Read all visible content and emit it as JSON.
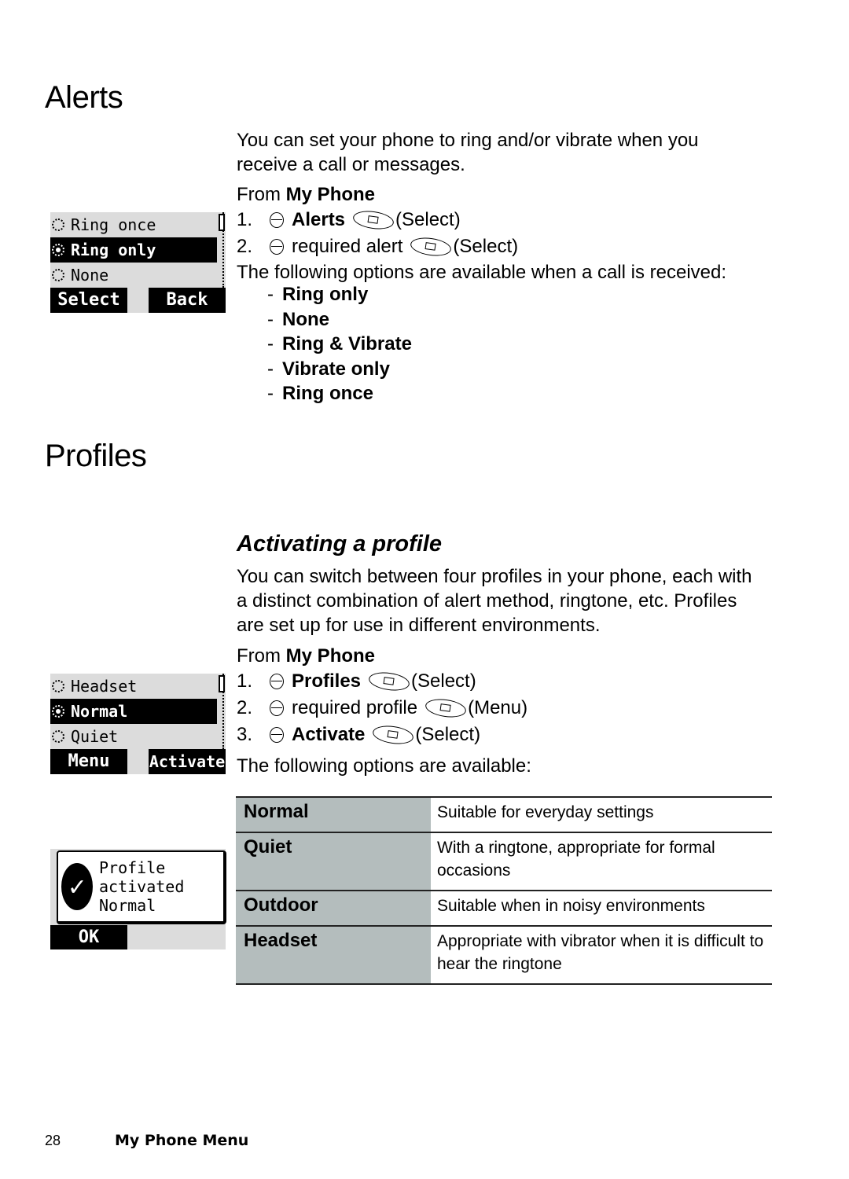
{
  "alerts": {
    "heading": "Alerts",
    "intro": "You can set your phone to ring and/or vibrate when you receive a call or messages.",
    "from_prefix": "From ",
    "from_menu": "My Phone",
    "steps": [
      {
        "num": "1.",
        "text": "Alerts",
        "bold": true,
        "key_label": "(Select)"
      },
      {
        "num": "2.",
        "text": "required alert",
        "bold": false,
        "key_label": "(Select)"
      }
    ],
    "options_intro": "The following options are available when a call is received:",
    "options": [
      "Ring only",
      "None",
      "Ring & Vibrate",
      "Vibrate only",
      "Ring once"
    ],
    "screen": {
      "items": [
        {
          "label": "Ring once",
          "selected": false
        },
        {
          "label": "Ring only",
          "selected": true
        },
        {
          "label": "None",
          "selected": false
        }
      ],
      "softkey_left": "Select",
      "softkey_right": "Back"
    }
  },
  "profiles": {
    "heading": "Profiles",
    "subheading": "Activating a profile",
    "intro": "You can switch between four profiles in your phone, each with a distinct combination of alert method, ringtone, etc. Profiles are set up for use in different environments.",
    "from_prefix": "From ",
    "from_menu": "My Phone",
    "steps": [
      {
        "num": "1.",
        "text": "Profiles",
        "bold": true,
        "key_label": "(Select)"
      },
      {
        "num": "2.",
        "text": "required profile",
        "bold": false,
        "key_label": "(Menu)"
      },
      {
        "num": "3.",
        "text": "Activate",
        "bold": true,
        "key_label": "(Select)"
      }
    ],
    "options_intro": "The following options are available:",
    "screen": {
      "items": [
        {
          "label": "Headset",
          "selected": false
        },
        {
          "label": "Normal",
          "selected": true
        },
        {
          "label": "Quiet",
          "selected": false
        }
      ],
      "softkey_left": "Menu",
      "softkey_right": "Activate"
    },
    "popup": {
      "lines": [
        "Profile",
        "activated",
        "Normal"
      ],
      "softkey": "OK"
    },
    "table": [
      {
        "name": "Normal",
        "desc": "Suitable for everyday settings"
      },
      {
        "name": "Quiet",
        "desc": "With a ringtone, appropriate for formal occasions"
      },
      {
        "name": "Outdoor",
        "desc": "Suitable when in noisy environments"
      },
      {
        "name": "Headset",
        "desc": "Appropriate with vibrator when it is difficult to hear the ringtone"
      }
    ]
  },
  "footer": {
    "page_number": "28",
    "section": "My Phone Menu"
  }
}
